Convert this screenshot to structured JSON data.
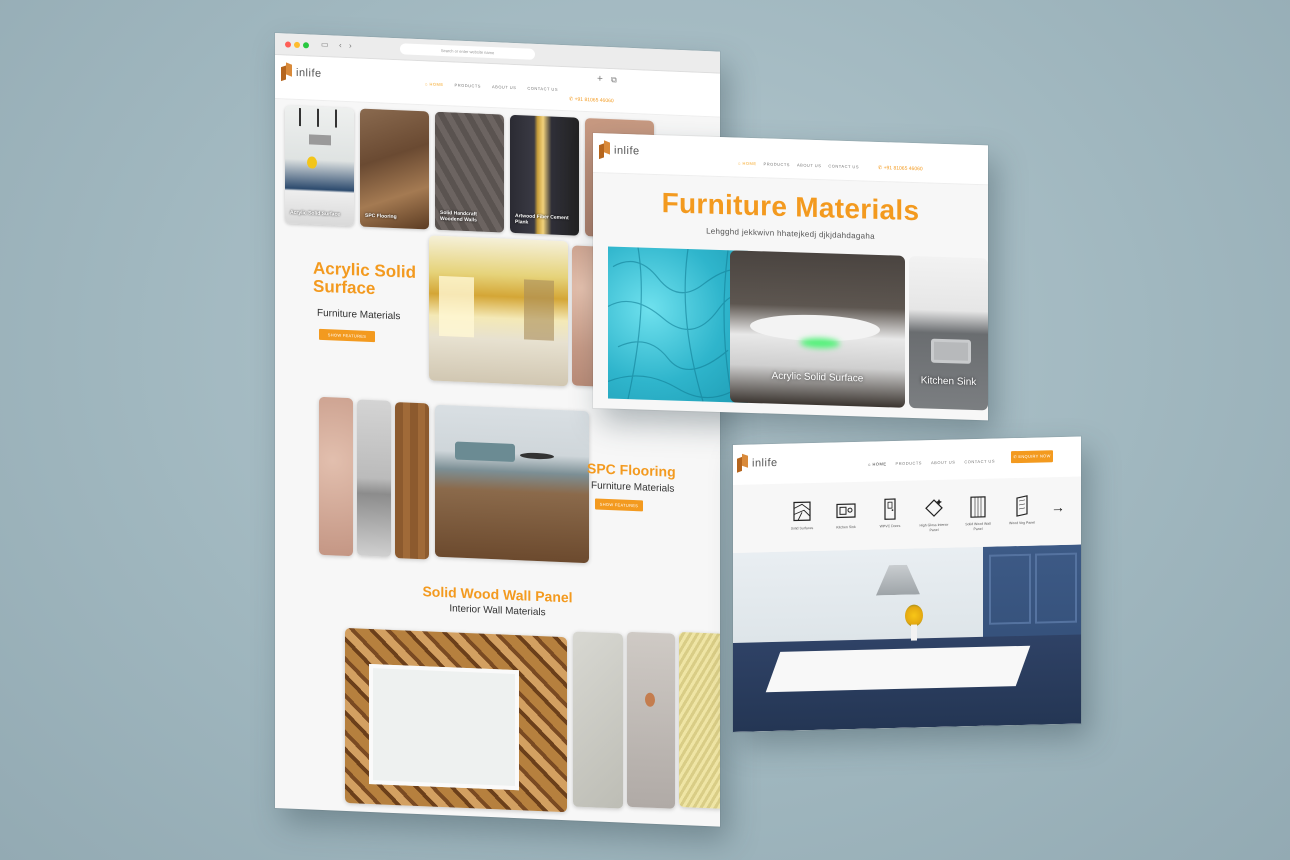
{
  "card_main": {
    "browser": {
      "address_placeholder": "Search or enter website name"
    },
    "logo_text": "inlife",
    "nav": [
      "HOME",
      "PRODUCTS",
      "ABOUT US",
      "CONTACT US"
    ],
    "phone": "+91 81065 46060",
    "tiles": [
      {
        "label": "Acrylic Solid Surface"
      },
      {
        "label": "SPC Flooring"
      },
      {
        "label": "Solid Handcraft Woodend Walls"
      },
      {
        "label": "Artwood Fiber Cement Plank"
      },
      {
        "label": ""
      }
    ],
    "section_acrylic": {
      "title_line1": "Acrylic Solid",
      "title_line2": "Surface",
      "subtitle": "Furniture Materials",
      "button": "SHOW FEATURES"
    },
    "section_spc": {
      "title": "SPC Flooring",
      "subtitle": "Furniture Materials",
      "button": "SHOW FEATURES"
    },
    "section_wood": {
      "title": "Solid Wood Wall Panel",
      "subtitle": "Interior Wall Materials"
    }
  },
  "card_furniture": {
    "logo_text": "inlife",
    "nav": [
      "HOME",
      "PRODUCTS",
      "ABOUT US",
      "CONTACT US"
    ],
    "phone": "+91 81065 46060",
    "title": "Furniture Materials",
    "subtitle": "Lehgghd jekkwivn hhatejkedj djkjdahdagaha",
    "strips": [
      {
        "label": ""
      },
      {
        "label": "Acrylic Solid Surface"
      },
      {
        "label": "Kitchen Sink"
      }
    ]
  },
  "card_home": {
    "logo_text": "inlife",
    "nav": [
      "HOME",
      "PRODUCTS",
      "ABOUT US",
      "CONTACT US"
    ],
    "cta": "ENQUIRY NOW",
    "categories": [
      {
        "label": "Solid Surfaces",
        "icon": "solid-surface-icon"
      },
      {
        "label": "Kitchen Sink",
        "icon": "kitchen-sink-icon"
      },
      {
        "label": "WPVC Doors",
        "icon": "door-icon"
      },
      {
        "label": "High Gloss Interior Panel",
        "icon": "sparkle-panel-icon"
      },
      {
        "label": "Solid Wood Wall Panel",
        "icon": "wood-panel-icon"
      },
      {
        "label": "Wood Veg Panel",
        "icon": "veneer-panel-icon"
      }
    ],
    "next_arrow": "→"
  },
  "colors": {
    "accent": "#f39a1f",
    "background": "#a3b9c0",
    "page": "#f7f7f7"
  }
}
